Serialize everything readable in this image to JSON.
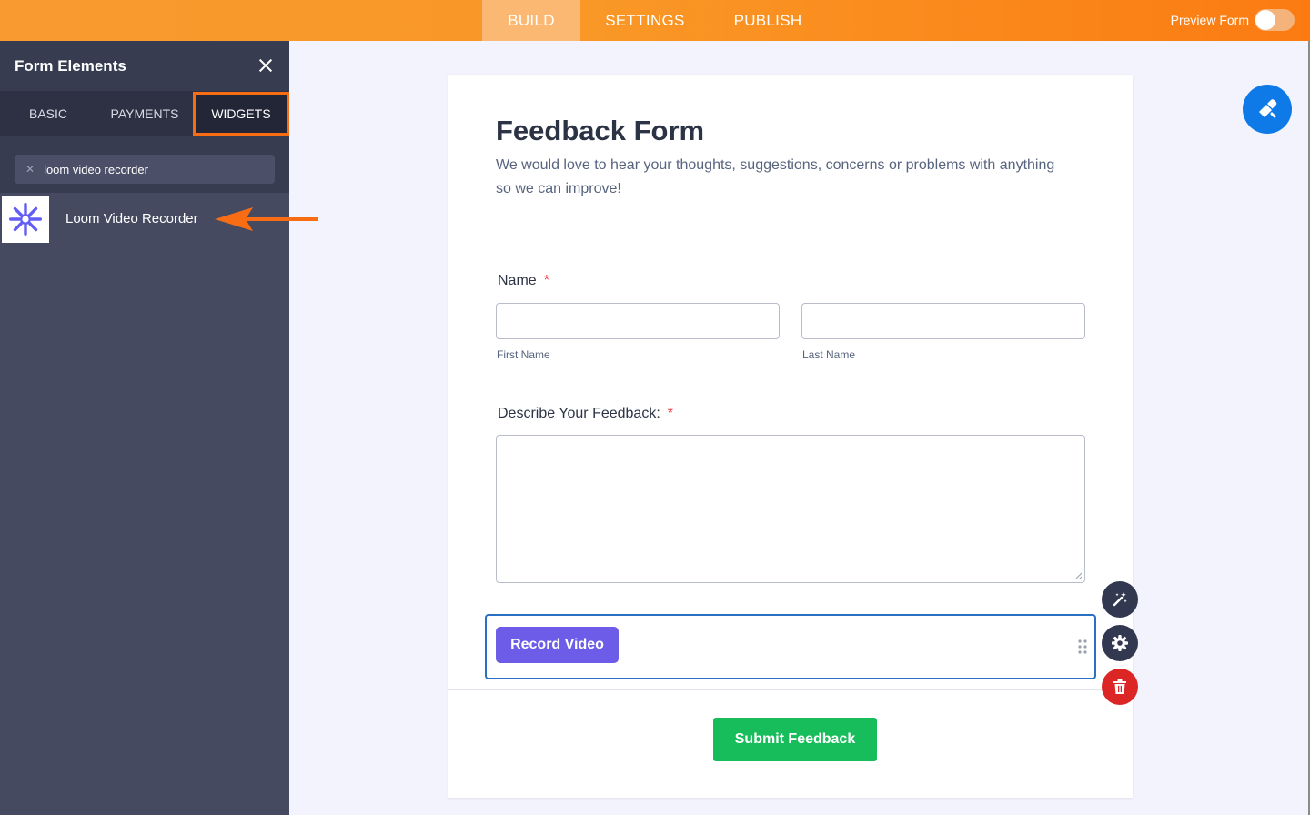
{
  "topbar": {
    "tabs": [
      {
        "label": "BUILD",
        "active": true
      },
      {
        "label": "SETTINGS",
        "active": false
      },
      {
        "label": "PUBLISH",
        "active": false
      }
    ],
    "preview_label": "Preview Form",
    "preview_on": false
  },
  "sidebar": {
    "title": "Form Elements",
    "tabs": [
      "BASIC",
      "PAYMENTS",
      "WIDGETS"
    ],
    "active_tab": "WIDGETS",
    "search_value": "loom video recorder",
    "results": [
      {
        "label": "Loom Video Recorder",
        "icon": "loom-icon"
      }
    ]
  },
  "form": {
    "title": "Feedback Form",
    "description": "We would love to hear your thoughts, suggestions, concerns or problems with anything so we can improve!",
    "name_label": "Name",
    "required_mark": "*",
    "first_name_sublabel": "First Name",
    "last_name_sublabel": "Last Name",
    "feedback_label": "Describe Your Feedback:",
    "record_button": "Record Video",
    "submit_button": "Submit Feedback"
  },
  "colors": {
    "accent_orange": "#f86d13",
    "record_purple": "#6c5ce7",
    "submit_green": "#18bd5b",
    "designer_blue": "#0d7ae8",
    "delete_red": "#dc2626"
  }
}
